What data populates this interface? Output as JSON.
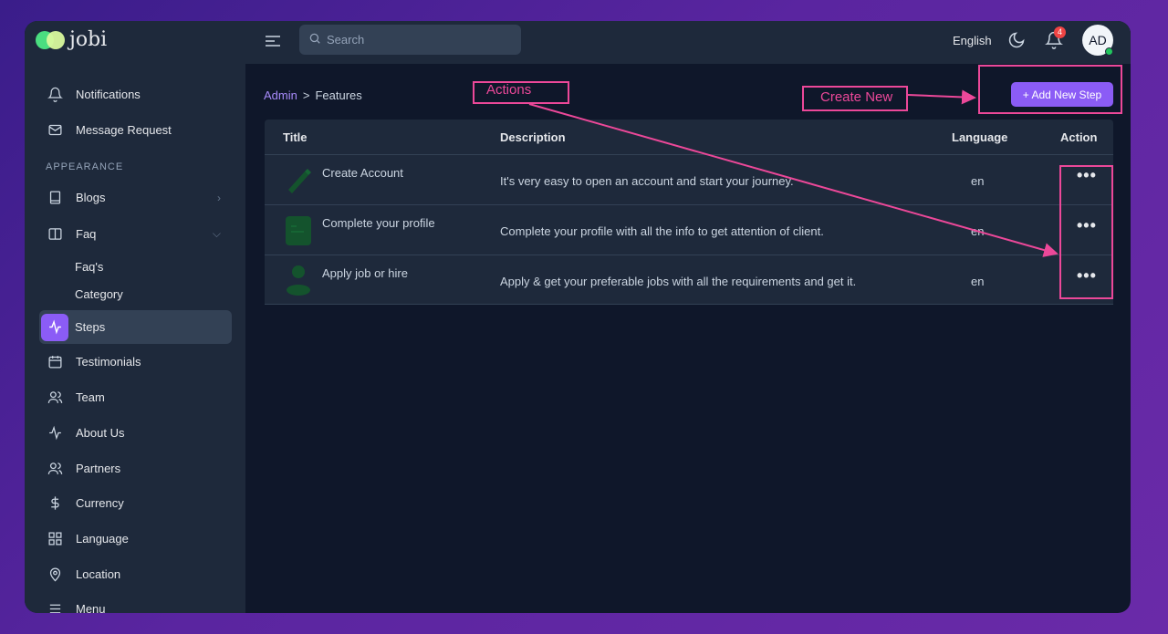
{
  "app": {
    "logo_text": "jobi"
  },
  "sidebar": {
    "items_top": [
      {
        "label": "Notifications",
        "icon": "bell-icon"
      },
      {
        "label": "Message Request",
        "icon": "mail-icon"
      }
    ],
    "section_label": "APPEARANCE",
    "items": [
      {
        "label": "Blogs",
        "icon": "book-icon"
      },
      {
        "label": "Faq",
        "icon": "columns-icon"
      },
      {
        "label": "Faq's"
      },
      {
        "label": "Category"
      },
      {
        "label": "Steps",
        "icon": "activity-icon"
      },
      {
        "label": "Testimonials",
        "icon": "calendar-icon"
      },
      {
        "label": "Team",
        "icon": "users-icon"
      },
      {
        "label": "About Us",
        "icon": "activity-icon"
      },
      {
        "label": "Partners",
        "icon": "users-icon"
      },
      {
        "label": "Currency",
        "icon": "dollar-icon"
      },
      {
        "label": "Language",
        "icon": "grid-icon"
      },
      {
        "label": "Location",
        "icon": "map-pin-icon"
      },
      {
        "label": "Menu",
        "icon": "menu-icon"
      }
    ]
  },
  "topbar": {
    "search_placeholder": "Search",
    "language": "English",
    "notification_count": "4",
    "avatar_initials": "AD"
  },
  "breadcrumb": {
    "root": "Admin",
    "separator": ">",
    "current": "Features"
  },
  "add_button": {
    "label": "+ Add New Step"
  },
  "table": {
    "headers": {
      "title": "Title",
      "description": "Description",
      "language": "Language",
      "action": "Action"
    },
    "rows": [
      {
        "title": "Create Account",
        "description": "It's very easy to open an account and start your journey.",
        "language": "en",
        "action": "•••"
      },
      {
        "title": "Complete your profile",
        "description": "Complete your profile with all the info to get attention of client.",
        "language": "en",
        "action": "•••"
      },
      {
        "title": "Apply job or hire",
        "description": "Apply & get your preferable jobs with all the requirements and get it.",
        "language": "en",
        "action": "•••"
      }
    ]
  },
  "annotations": {
    "actions": "Actions",
    "create_new": "Create New"
  },
  "colors": {
    "accent": "#8b5cf6",
    "annotation": "#ec4899",
    "sidebar_bg": "#1e293b",
    "content_bg": "#0f172a"
  }
}
